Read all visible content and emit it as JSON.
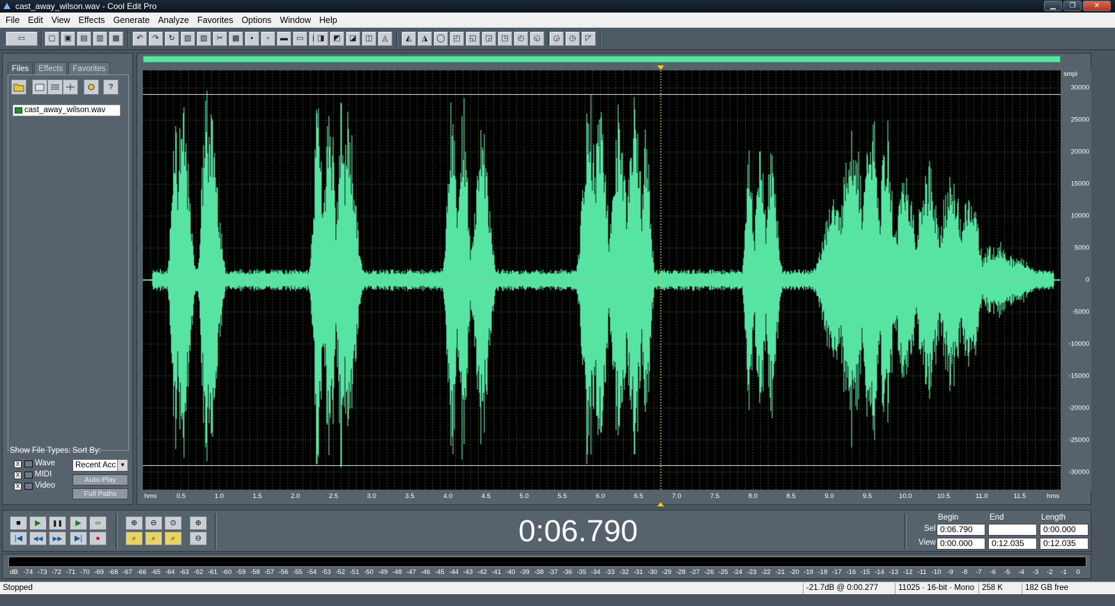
{
  "window": {
    "title": "cast_away_wilson.wav - Cool Edit Pro",
    "minimize": "▁",
    "maximize": "❐",
    "close": "✕"
  },
  "menu": [
    "File",
    "Edit",
    "View",
    "Effects",
    "Generate",
    "Analyze",
    "Favorites",
    "Options",
    "Window",
    "Help"
  ],
  "toolbar_icons": [
    "multitrack-icon",
    "new-file-icon",
    "open-file-icon",
    "save-icon",
    "save-as-icon",
    "close-file-icon",
    "undo-icon",
    "redo-icon",
    "repeat-icon",
    "copy-to-new-icon",
    "copy-icon",
    "cut-icon",
    "paste-icon",
    "paste-new-icon",
    "mix-paste-icon",
    "trim-icon",
    "delete-icon",
    "spectral-view-icon",
    "waveform-view-icon",
    "marker-list-icon",
    "cue-list-icon",
    "play-list-icon",
    "properties-icon",
    "time-format-icon",
    "settings-icon",
    "snap-icon",
    "zoom-settings-icon",
    "frequency-analysis-icon",
    "metronome-icon",
    "timecode-icon",
    "statistics-icon",
    "spectrum-icon",
    "scripts-icon",
    "batch-icon",
    "cd-icon",
    "help-icon"
  ],
  "left_panel": {
    "tabs": [
      "Files",
      "Effects",
      "Favorites"
    ],
    "active_tab": "Files",
    "files": [
      "cast_away_wilson.wav"
    ],
    "show_file_types_label": "Show File Types:",
    "sort_by_label": "Sort By:",
    "file_types": [
      {
        "label": "Wave",
        "checked": "X"
      },
      {
        "label": "MIDI",
        "checked": "X"
      },
      {
        "label": "Video",
        "checked": "X"
      }
    ],
    "sort_value": "Recent Acc",
    "auto_play": "Auto-Play",
    "full_paths": "Full Paths"
  },
  "waveform": {
    "color": "#57e3a2",
    "grid_color": "#1f4a2a",
    "y_unit": "smpl",
    "y_ticks": [
      "30000",
      "25000",
      "20000",
      "15000",
      "10000",
      "5000",
      "0",
      "-5000",
      "-10000",
      "-15000",
      "-20000",
      "-25000",
      "-30000"
    ],
    "x_unit_left": "hms",
    "x_unit_right": "hms",
    "x_ticks": [
      "0.5",
      "1.0",
      "1.5",
      "2.0",
      "2.5",
      "3.0",
      "3.5",
      "4.0",
      "4.5",
      "5.0",
      "5.5",
      "6.0",
      "6.5",
      "7.0",
      "7.5",
      "8.0",
      "8.5",
      "9.0",
      "9.5",
      "10.0",
      "10.5",
      "11.0",
      "11.5"
    ],
    "duration_seconds": 12.035,
    "cursor_seconds": 6.79,
    "y_max": 32767
  },
  "transport": {
    "time": "0:06.790",
    "headers": {
      "begin": "Begin",
      "end": "End",
      "length": "Length"
    },
    "sel_label": "Sel",
    "view_label": "View",
    "sel": {
      "begin": "0:06.790",
      "end": "",
      "length": "0:00.000"
    },
    "view": {
      "begin": "0:00.000",
      "end": "0:12.035",
      "length": "0:12.035"
    },
    "buttons": {
      "stop": "■",
      "play": "▶",
      "pause": "❚❚",
      "play_to_end": "▶",
      "loop": "∞",
      "go_begin": "|◀",
      "rewind": "◀◀",
      "fast_forward": "▶▶",
      "go_end": "▶|",
      "record": "●"
    },
    "zoom_buttons": {
      "zoom_in_h": "⊕",
      "zoom_out_h": "⊖",
      "zoom_full": "⊙",
      "zoom_in_v": "⊕",
      "zoom_sel": "⌕",
      "zoom_left": "⌕",
      "zoom_right": "⌕",
      "zoom_out_v": "⊖"
    }
  },
  "meter": {
    "labels": [
      "dB",
      "-74",
      "-73",
      "-72",
      "-71",
      "-70",
      "-69",
      "-68",
      "-67",
      "-66",
      "-65",
      "-64",
      "-63",
      "-62",
      "-61",
      "-60",
      "-59",
      "-58",
      "-57",
      "-56",
      "-55",
      "-54",
      "-53",
      "-52",
      "-51",
      "-50",
      "-49",
      "-48",
      "-47",
      "-46",
      "-45",
      "-44",
      "-43",
      "-42",
      "-41",
      "-40",
      "-39",
      "-38",
      "-37",
      "-36",
      "-35",
      "-34",
      "-33",
      "-32",
      "-31",
      "-30",
      "-29",
      "-28",
      "-27",
      "-26",
      "-25",
      "-24",
      "-23",
      "-22",
      "-21",
      "-20",
      "-19",
      "-18",
      "-17",
      "-16",
      "-15",
      "-14",
      "-13",
      "-12",
      "-11",
      "-10",
      "-9",
      "-8",
      "-7",
      "-6",
      "-5",
      "-4",
      "-3",
      "-2",
      "-1",
      "0"
    ]
  },
  "status": {
    "state": "Stopped",
    "level": "-21.7dB @  0:00.277",
    "format": "11025 · 16-bit · Mono",
    "size": "258 K",
    "free": "182 GB free"
  }
}
